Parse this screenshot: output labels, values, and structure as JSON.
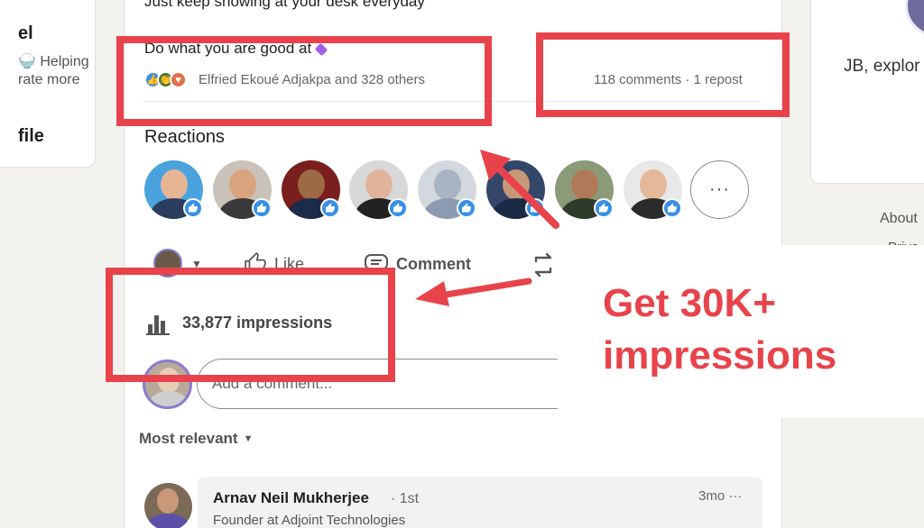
{
  "left_card": {
    "name_fragment": "el",
    "line1": "Helping",
    "line2": "rate more",
    "profile_fragment": "file"
  },
  "right_card": {
    "text": "JB, explor",
    "footer_about": "About",
    "footer_privacy": "Priva"
  },
  "post": {
    "line1": "Just keep showing at your desk everyday",
    "line2": "Do what you are good at",
    "reactors": "Elfried Ekoué Adjakpa and 328 others",
    "comments_reposts": "118 comments · 1 repost"
  },
  "reactions": {
    "title": "Reactions",
    "more_label": "···",
    "avatars": [
      {
        "name": "reactor-1",
        "skin": "#e6b596",
        "shirt": "#2a3d5c",
        "bg": "#4aa3df"
      },
      {
        "name": "reactor-2",
        "skin": "#d9a37e",
        "shirt": "#3a3a3a",
        "bg": "#c9c2b8"
      },
      {
        "name": "reactor-3",
        "skin": "#9c6a45",
        "shirt": "#1d2b4a",
        "bg": "#7a1e1e"
      },
      {
        "name": "reactor-4",
        "skin": "#e0b49a",
        "shirt": "#222222",
        "bg": "#d8d8d8"
      },
      {
        "name": "reactor-5",
        "skin": "#a8b4c4",
        "shirt": "#8c9bb0",
        "bg": "#d3d8de"
      },
      {
        "name": "reactor-6",
        "skin": "#c79878",
        "shirt": "#1a2a44",
        "bg": "#34466a"
      },
      {
        "name": "reactor-7",
        "skin": "#b07a58",
        "shirt": "#2e3a2a",
        "bg": "#8b9a78"
      },
      {
        "name": "reactor-8",
        "skin": "#e4b898",
        "shirt": "#2b2b2b",
        "bg": "#e8e8e8"
      }
    ]
  },
  "actions": {
    "like": "Like",
    "comment": "Comment"
  },
  "overlay": {
    "headline": "Get 30K+ impressions"
  },
  "impressions": {
    "text": "33,877 impressions"
  },
  "comment_box": {
    "placeholder": "Add a comment..."
  },
  "sort": {
    "label": "Most relevant"
  },
  "first_comment": {
    "name": "Arnav Neil Mukherjee",
    "degree": "· 1st",
    "title": "Founder at Adjoint Technologies",
    "time": "3mo ···"
  },
  "colors": {
    "highlight_red": "#e8434b",
    "like_blue": "#378fe9",
    "overlay_text": "#e8434b"
  }
}
